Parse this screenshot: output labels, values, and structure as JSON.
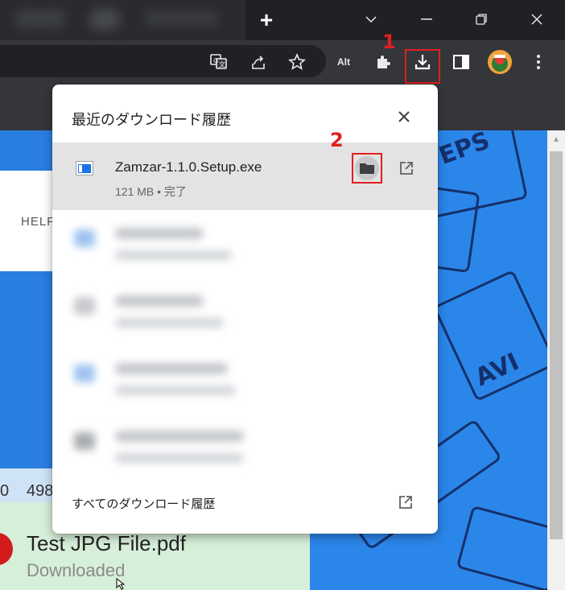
{
  "annotations": {
    "step1": "1",
    "step2": "2"
  },
  "toolbar": {
    "alt_label": "Alt"
  },
  "page": {
    "help_text": "HELF",
    "row_number": "498",
    "row_prefix": "0",
    "file_title": "Test JPG File.pdf",
    "file_status": "Downloaded",
    "doodle_eps": "EPS",
    "doodle_avi": "AVI"
  },
  "download_bubble": {
    "title": "最近のダウンロード履歴",
    "active_item": {
      "filename": "Zamzar-1.1.0.Setup.exe",
      "meta": "121 MB • 完了"
    },
    "footer_label": "すべてのダウンロード履歴"
  },
  "colors": {
    "annotation_red": "#e02020",
    "page_blue": "#2a7de1"
  },
  "icons": [
    "translate-icon",
    "share-icon",
    "bookmark-star-icon",
    "extensions-icon",
    "download-icon",
    "side-panel-icon",
    "profile-avatar",
    "more-menu-icon",
    "close-icon",
    "folder-icon",
    "open-external-icon"
  ]
}
